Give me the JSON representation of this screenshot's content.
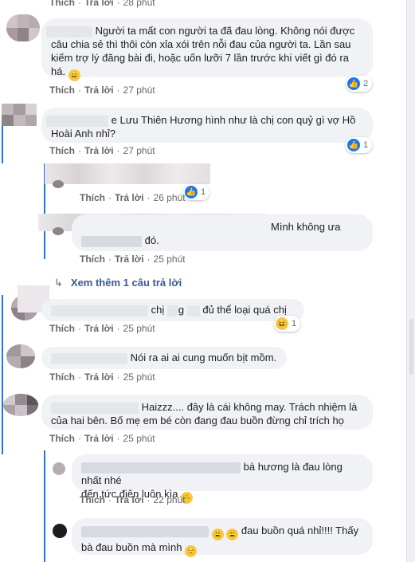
{
  "actions": {
    "like": "Thích",
    "reply": "Trả lời",
    "sep": "·"
  },
  "comments": [
    {
      "time": "28 phút"
    },
    {
      "text": "Người ta mất con người ta đã đau lòng. Không nói được câu chia sẻ thì thôi còn xỉa xói trên nỗi đau của người ta. Lần sau kiếm trợ lý đăng bài đi, hoặc uốn lưỡi 7 lần trước khi viết gì đó ra há.",
      "time": "27 phút",
      "reaction_count": "2"
    },
    {
      "mention_tail": "e Lưu Thiên Hương hình như là chị con quỷ gì vợ Hồ",
      "text2": "Hoài Anh nhỉ?",
      "time": "27 phút",
      "reaction_count": "1"
    },
    {
      "time": "26 phút",
      "reaction_count": "1"
    },
    {
      "text_end": "Mình không ưa",
      "text2": "đó.",
      "time": "25 phút"
    },
    {
      "more_replies": "Xem thêm 1 câu trả lời"
    },
    {
      "t1": "chị",
      "t2": "g",
      "t3": "đủ thể loại quá chị",
      "time": "25 phút",
      "reaction_count": "1"
    },
    {
      "text": "Nói ra ai ai cung muốn bịt mồm.",
      "time": "25 phút"
    },
    {
      "text1": "Haizzz.... đây là cái không may. Trách nhiệm là",
      "text2": "của hai bên. Bố mẹ em bé còn đang đau buồn đừng chỉ trích họ",
      "time": "25 phút"
    },
    {
      "text1": "bà hương là đau lòng nhất nhé",
      "text2": "đến tức điên luôn kìa",
      "time": "22 phút"
    },
    {
      "text1": "đau buồn quá nhỉ!!!! Thấy",
      "text2": "bà đau buồn mà mình"
    }
  ]
}
